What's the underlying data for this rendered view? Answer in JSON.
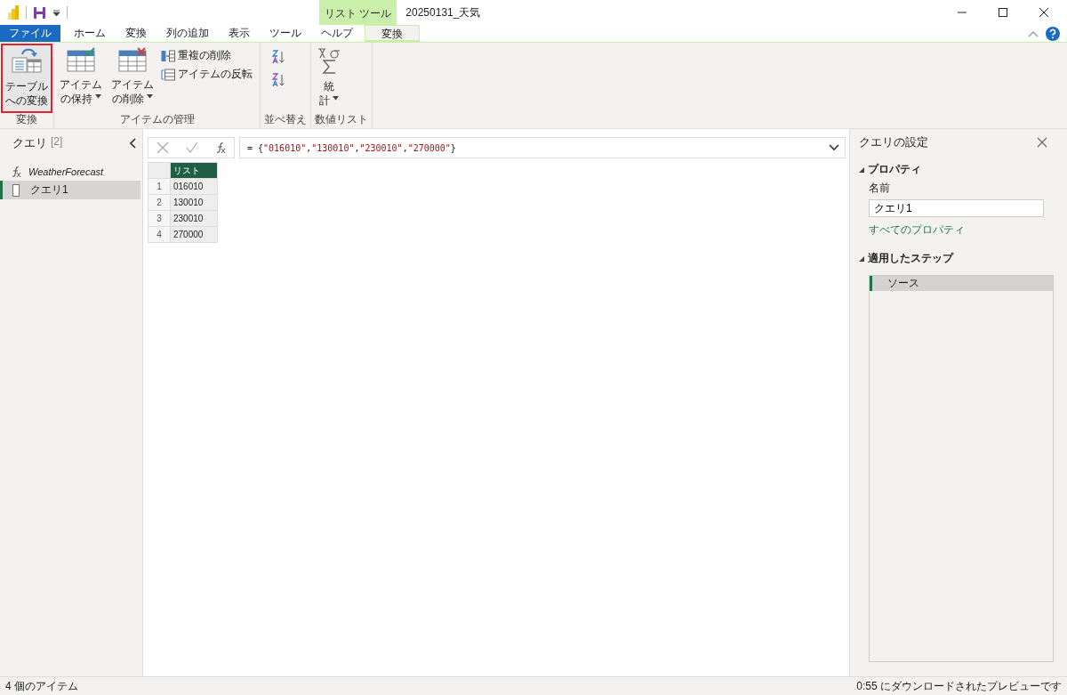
{
  "window": {
    "title": "20250131_天気",
    "context_tab_group": "リスト ツール"
  },
  "tabs": [
    {
      "label": "ファイル",
      "kind": "file",
      "selected": false
    },
    {
      "label": "ホーム",
      "kind": "tab",
      "selected": false
    },
    {
      "label": "変換",
      "kind": "tab",
      "selected": false
    },
    {
      "label": "列の追加",
      "kind": "tab",
      "selected": false
    },
    {
      "label": "表示",
      "kind": "tab",
      "selected": false
    },
    {
      "label": "ツール",
      "kind": "tab",
      "selected": false
    },
    {
      "label": "ヘルプ",
      "kind": "tab",
      "selected": false
    },
    {
      "label": "変換",
      "kind": "context",
      "selected": true
    }
  ],
  "ribbon": {
    "groups": [
      {
        "label": "変換",
        "items": [
          {
            "kind": "large",
            "lines": [
              "テーブル",
              "への変換"
            ],
            "dropdown": false,
            "highlighted": true
          }
        ]
      },
      {
        "label": "アイテムの管理",
        "items": [
          {
            "kind": "large",
            "lines": [
              "アイテム",
              "の保持"
            ],
            "dropdown": true,
            "highlighted": false
          },
          {
            "kind": "large",
            "lines": [
              "アイテム",
              "の削除"
            ],
            "dropdown": true,
            "highlighted": false
          },
          {
            "kind": "stack",
            "entries": [
              {
                "label": "重複の削除"
              },
              {
                "label": "アイテムの反転"
              }
            ]
          }
        ]
      },
      {
        "label": "並べ替え",
        "items": [
          {
            "kind": "icons",
            "entries": [
              {
                "kind": "ascending"
              },
              {
                "kind": "descending"
              }
            ]
          }
        ]
      },
      {
        "label": "数値リスト",
        "items": [
          {
            "kind": "large",
            "lines": [
              "統",
              "計"
            ],
            "dropdown": true,
            "highlighted": false
          }
        ]
      }
    ]
  },
  "queries_pane": {
    "title": "クエリ",
    "count": "[2]",
    "items": [
      {
        "label": "WeatherForecast",
        "kind": "function",
        "selected": false
      },
      {
        "label": "クエリ1",
        "kind": "list",
        "selected": true
      }
    ]
  },
  "formula_bar": {
    "tokens": [
      {
        "text": "= {",
        "kind": "plain"
      },
      {
        "text": "\"016010\"",
        "kind": "string"
      },
      {
        "text": ",",
        "kind": "plain"
      },
      {
        "text": "\"130010\"",
        "kind": "string"
      },
      {
        "text": ",",
        "kind": "plain"
      },
      {
        "text": "\"230010\"",
        "kind": "string"
      },
      {
        "text": ",",
        "kind": "plain"
      },
      {
        "text": "\"270000\"",
        "kind": "string"
      },
      {
        "text": "}",
        "kind": "plain"
      }
    ]
  },
  "table": {
    "columns": [
      "リスト"
    ],
    "rows": [
      {
        "index": "1",
        "cells": [
          "016010"
        ]
      },
      {
        "index": "2",
        "cells": [
          "130010"
        ]
      },
      {
        "index": "3",
        "cells": [
          "230010"
        ]
      },
      {
        "index": "4",
        "cells": [
          "270000"
        ]
      }
    ]
  },
  "settings_pane": {
    "title": "クエリの設定",
    "properties": {
      "heading": "プロパティ",
      "name_label": "名前",
      "name_value": "クエリ1",
      "link": "すべてのプロパティ"
    },
    "steps": {
      "heading": "適用したステップ",
      "items": [
        {
          "label": "ソース",
          "selected": true
        }
      ]
    }
  },
  "status_bar": {
    "left": "4 個のアイテム",
    "right": "0:55 にダウンロードされたプレビューです"
  }
}
